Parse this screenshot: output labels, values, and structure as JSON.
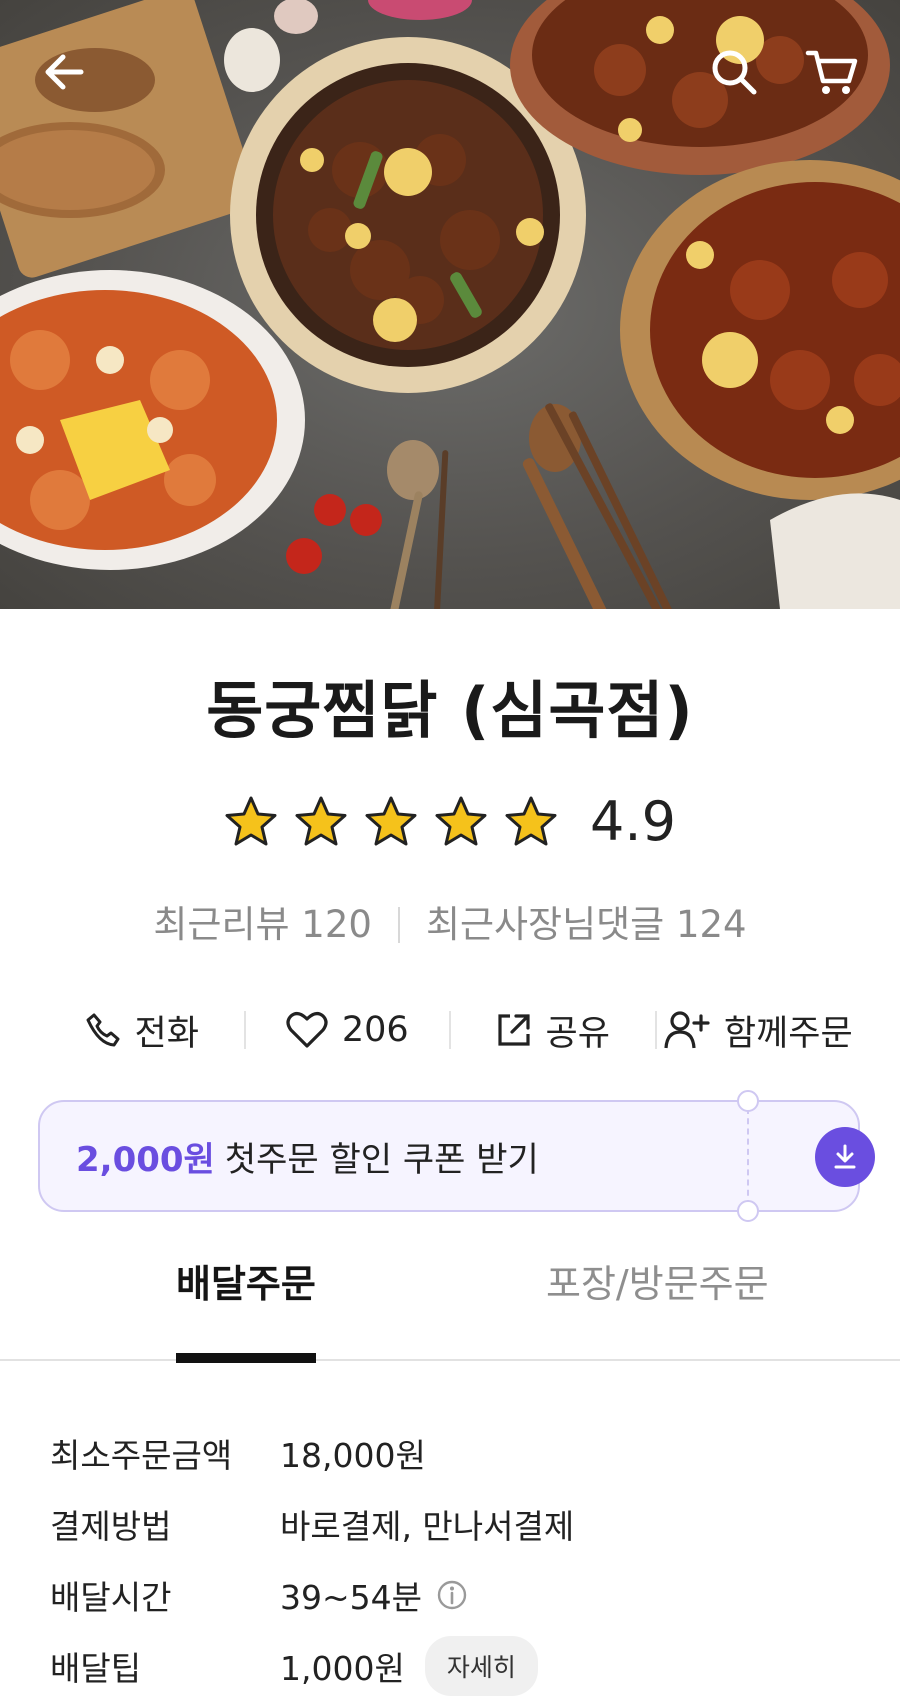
{
  "hero": {
    "icons": [
      "back-arrow-icon",
      "search-icon",
      "cart-icon"
    ]
  },
  "store": {
    "name": "동궁찜닭 (심곡점)",
    "rating": "4.9",
    "rating_stars": 5,
    "recent_reviews": "최근리뷰 120",
    "owner_replies": "최근사장님댓글 124"
  },
  "actions": {
    "call": "전화",
    "likes": "206",
    "share": "공유",
    "group_order": "함께주문"
  },
  "coupon": {
    "amount": "2,000원",
    "text": "첫주문 할인 쿠폰 받기"
  },
  "tabs": {
    "delivery": "배달주문",
    "pickup": "포장/방문주문"
  },
  "info": {
    "min_order_label": "최소주문금액",
    "min_order_value": "18,000원",
    "payment_label": "결제방법",
    "payment_value": "바로결제, 만나서결제",
    "delivery_time_label": "배달시간",
    "delivery_time_value": "39~54분",
    "delivery_tip_label": "배달팁",
    "delivery_tip_value": "1,000원",
    "detail_chip": "자세히"
  },
  "colors": {
    "accent": "#6a4ee0",
    "coupon_bg": "#f6f4ff",
    "star": "#f5c21b"
  }
}
